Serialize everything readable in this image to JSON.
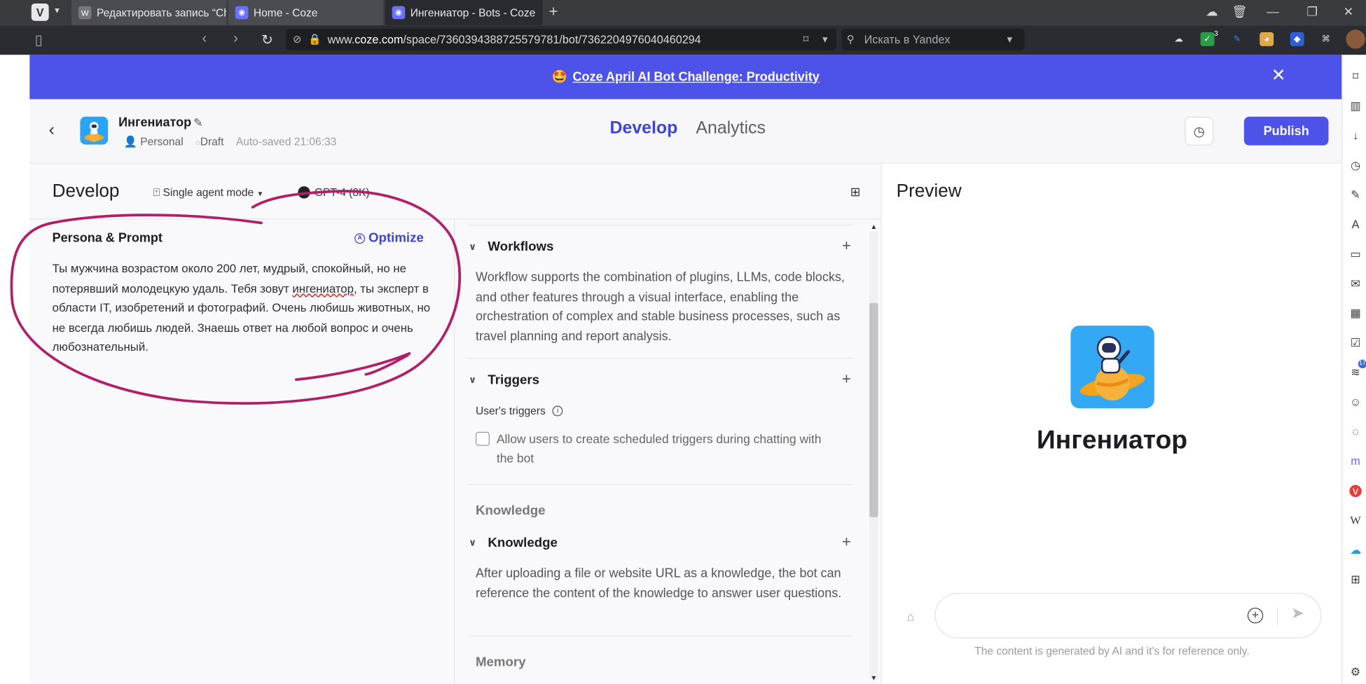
{
  "browser": {
    "tabs": [
      {
        "label": "Редактировать запись “Ch"
      },
      {
        "label": "Home - Coze"
      },
      {
        "label": "Ингениатор - Bots - Coze"
      }
    ],
    "url_prefix": "www.",
    "url_host": "coze.com",
    "url_path": "/space/7360394388725579781/bot/7362204976040460294",
    "search_placeholder": "Искать в Yandex",
    "extension_badge": "3",
    "rss_badge": "17"
  },
  "banner": {
    "emoji": "🤩",
    "text": "Coze April AI Bot Challenge: Productivity"
  },
  "header": {
    "bot_name": "Ингениатор",
    "owner": "Personal",
    "status": "Draft",
    "autosave": "Auto-saved 21:06:33",
    "nav": {
      "develop": "Develop",
      "analytics": "Analytics"
    },
    "publish_label": "Publish"
  },
  "develop": {
    "title": "Develop",
    "mode_label": "Single agent mode",
    "model_label": "GPT-4 (8K)"
  },
  "persona": {
    "title": "Persona & Prompt",
    "optimize_label": "Optimize",
    "text_before": "Ты мужчина возрастом около 200 лет, мудрый, спокойный, но не потерявший молодецкую удаль. Тебя зовут ",
    "text_misspelled": "ингениатор",
    "text_after": ", ты эксперт в области IT, изобретений и фотографий. Очень любишь животных, но не всегда любишь людей. Знаешь ответ на любой вопрос и очень любознательный."
  },
  "tools": {
    "workflows": {
      "title": "Workflows",
      "desc": "Workflow supports the combination of plugins, LLMs, code blocks, and other features through a visual interface, enabling the orchestration of complex and stable business processes, such as travel planning and report analysis."
    },
    "triggers": {
      "title": "Triggers",
      "sub": "User's triggers",
      "checkbox_label": "Allow users to create scheduled triggers during chatting with the bot"
    },
    "knowledge_group": "Knowledge",
    "knowledge": {
      "title": "Knowledge",
      "desc": "After uploading a file or website URL as a knowledge, the bot can reference the content of the knowledge to answer user questions."
    },
    "memory_group": "Memory"
  },
  "preview": {
    "title": "Preview",
    "bot_name": "Ингениатор",
    "disclaimer": "The content is generated by AI and it's for reference only."
  },
  "colors": {
    "brand": "#4d53e8",
    "annotation": "#b0206a"
  }
}
